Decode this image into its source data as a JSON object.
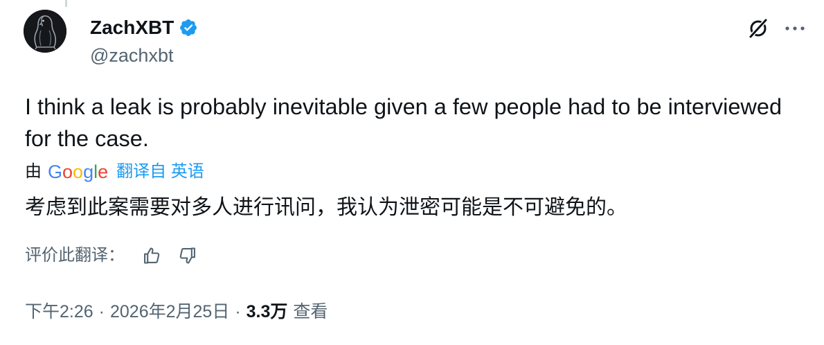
{
  "author": {
    "display_name": "ZachXBT",
    "handle": "@zachxbt",
    "verified": true
  },
  "tweet": {
    "text": "I think a leak is probably inevitable given a few people had to be interviewed for the case."
  },
  "translation": {
    "by_label": "由",
    "provider": "Google",
    "translated_from_label": "翻译自 英语",
    "translated_text": "考虑到此案需要对多人进行讯问，我认为泄密可能是不可避免的。",
    "rate_label": "评价此翻译："
  },
  "meta": {
    "time": "下午2:26",
    "separator": "·",
    "date": "2026年2月25日",
    "views_count": "3.3万",
    "views_label": "查看"
  },
  "icons": {
    "verified": "verified-badge-icon",
    "grok": "grok-icon",
    "more": "more-options-icon",
    "thumbs_up": "thumbs-up-icon",
    "thumbs_down": "thumbs-down-icon"
  },
  "colors": {
    "text_primary": "#0f1419",
    "text_secondary": "#536471",
    "accent": "#1d9bf0",
    "thread_line": "#cfd9de",
    "google_blue": "#4285f4",
    "google_red": "#ea4335",
    "google_yellow": "#fbbc05",
    "google_green": "#34a853"
  }
}
